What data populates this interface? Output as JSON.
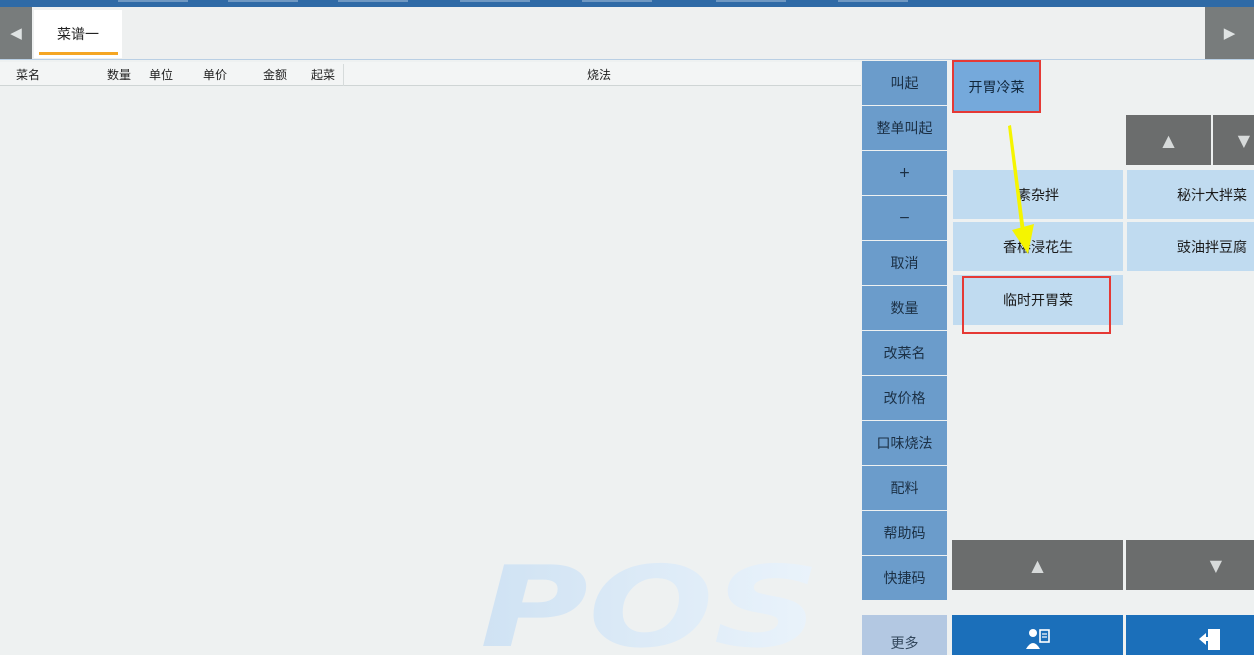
{
  "tabs": [
    {
      "label": "菜谱一",
      "active": true
    }
  ],
  "order_table": {
    "columns": [
      "菜名",
      "数量",
      "单位",
      "单价",
      "金额",
      "起菜",
      "烧法"
    ]
  },
  "watermark": {
    "text": "POS"
  },
  "side_buttons": [
    "叫起",
    "整单叫起",
    "+",
    "−",
    "取消",
    "数量",
    "改菜名",
    "改价格",
    "口味烧法",
    "配料",
    "帮助码",
    "快捷码"
  ],
  "more_button": "更多",
  "category": {
    "label": "开胃冷菜"
  },
  "dishes": [
    "素杂拌",
    "秘汁大拌菜",
    "香椿浸花生",
    "豉油拌豆腐",
    "临时开胃菜"
  ],
  "icons": {
    "tab_left": "triangle-left-icon",
    "tab_right": "triangle-right-icon",
    "page_up": "triangle-up-icon",
    "page_down": "triangle-down-icon",
    "action_1": "person-document-icon",
    "action_2": "exit-door-icon"
  },
  "colors": {
    "top_bar": "#2f6aa6",
    "side_button": "#6b9ccb",
    "dish_button": "#c0dbf0",
    "nav_button": "#6b6d6d",
    "action_button": "#1b6fba",
    "highlight": "#e53935",
    "annotation_arrow": "#f5f500",
    "tab_underline": "#f5a623"
  }
}
